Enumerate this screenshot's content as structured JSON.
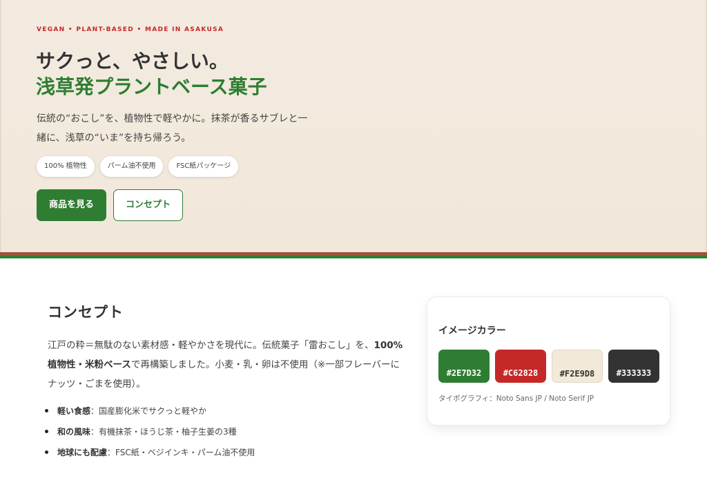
{
  "hero": {
    "eyebrow": "VEGAN • PLANT-BASED • MADE IN ASAKUSA",
    "headline_line1": "サクっと、やさしい。",
    "headline_line2": "浅草発プラントベース菓子",
    "lead": "伝統の“おこし”を、植物性で軽やかに。抹茶が香るサブレと一緒に、浅草の“いま”を持ち帰ろう。",
    "chips": [
      "100% 植物性",
      "パーム油不使用",
      "FSC紙パッケージ"
    ],
    "primary_button": "商品を見る",
    "secondary_button": "コンセプト"
  },
  "concept": {
    "title": "コンセプト",
    "body_1": "江戸の粋＝無駄のない素材感・軽やかさを現代に。伝統菓子「雷おこし」を、",
    "body_bold": "100%植物性・米粉ベース",
    "body_2": "で再構築しました。小麦・乳・卵は不使用（※一部フレーバーにナッツ・ごまを使用）。",
    "features": [
      {
        "title": "軽い食感",
        "text": "国産膨化米でサクっと軽やか"
      },
      {
        "title": "和の風味",
        "text": "有機抹茶・ほうじ茶・柚子生姜の3種"
      },
      {
        "title": "地球にも配慮",
        "text": "FSC紙・ベジインキ・パーム油不使用"
      }
    ]
  },
  "palette": {
    "title": "イメージカラー",
    "swatches": [
      {
        "label": "#2E7D32",
        "color": "#2E7D32"
      },
      {
        "label": "#C62828",
        "color": "#C62828"
      },
      {
        "label": "#F2E9D8",
        "color": "#F2E9D8"
      },
      {
        "label": "#333333",
        "color": "#333333"
      }
    ],
    "typography": "タイポグラフィ：Noto Sans JP / Noto Serif JP"
  },
  "colors": {
    "green": "#2e7d32",
    "red": "#c62828",
    "cream": "#f2e9d8",
    "ink": "#333333"
  }
}
